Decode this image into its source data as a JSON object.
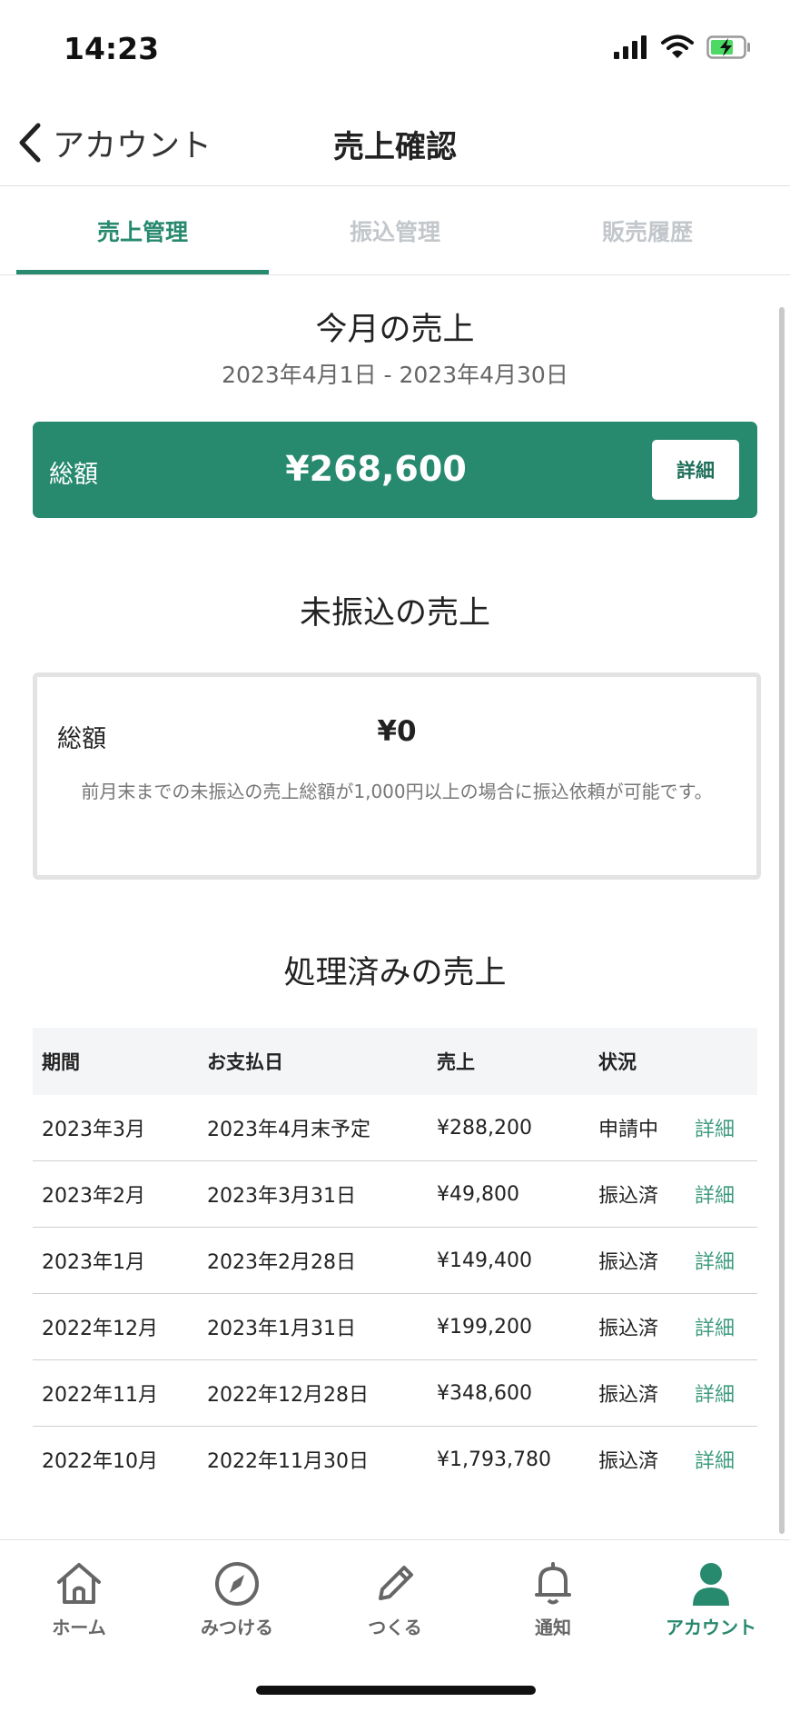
{
  "status_bar": {
    "time": "14:23"
  },
  "nav": {
    "back_label": "アカウント",
    "title": "売上確認"
  },
  "tabs": [
    {
      "label": "売上管理",
      "active": true
    },
    {
      "label": "振込管理",
      "active": false
    },
    {
      "label": "販売履歴",
      "active": false
    }
  ],
  "this_month": {
    "title": "今月の売上",
    "period": "2023年4月1日 - 2023年4月30日",
    "total_label": "総額",
    "total_amount": "¥268,600",
    "detail_label": "詳細"
  },
  "unpaid": {
    "title": "未振込の売上",
    "total_label": "総額",
    "total_amount": "¥0",
    "note": "前月末までの未振込の売上総額が1,000円以上の場合に振込依頼が可能です。"
  },
  "processed": {
    "title": "処理済みの売上",
    "columns": [
      "期間",
      "お支払日",
      "売上",
      "状況"
    ],
    "detail_label": "詳細",
    "rows": [
      {
        "period": "2023年3月",
        "pay_date": "2023年4月末予定",
        "amount": "¥288,200",
        "status": "申請中"
      },
      {
        "period": "2023年2月",
        "pay_date": "2023年3月31日",
        "amount": "¥49,800",
        "status": "振込済"
      },
      {
        "period": "2023年1月",
        "pay_date": "2023年2月28日",
        "amount": "¥149,400",
        "status": "振込済"
      },
      {
        "period": "2022年12月",
        "pay_date": "2023年1月31日",
        "amount": "¥199,200",
        "status": "振込済"
      },
      {
        "period": "2022年11月",
        "pay_date": "2022年12月28日",
        "amount": "¥348,600",
        "status": "振込済"
      },
      {
        "period": "2022年10月",
        "pay_date": "2022年11月30日",
        "amount": "¥1,793,780",
        "status": "振込済"
      }
    ]
  },
  "tab_bar": [
    {
      "label": "ホーム",
      "icon": "home-icon",
      "active": false
    },
    {
      "label": "みつける",
      "icon": "compass-icon",
      "active": false
    },
    {
      "label": "つくる",
      "icon": "pencil-icon",
      "active": false
    },
    {
      "label": "通知",
      "icon": "bell-icon",
      "active": false
    },
    {
      "label": "アカウント",
      "icon": "person-icon",
      "active": true
    }
  ],
  "colors": {
    "accent": "#27896e",
    "inactive_tab": "#c3c7cb",
    "link": "#3f9b7f"
  }
}
